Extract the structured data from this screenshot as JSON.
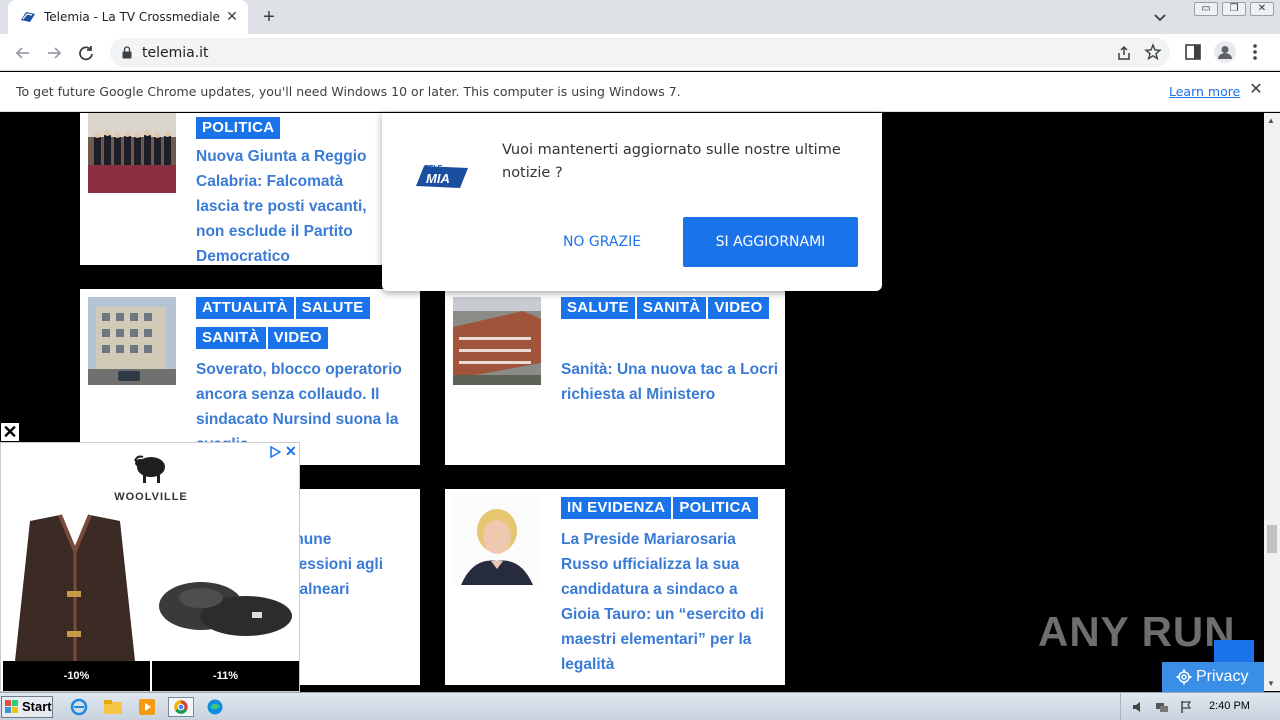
{
  "browser": {
    "tab_title": "Telemia - La TV Crossmediale",
    "url": "telemia.it",
    "infobar_text": "To get future Google Chrome updates, you'll need Windows 10 or later. This computer is using Windows 7.",
    "infobar_link": "Learn more"
  },
  "articles": [
    {
      "tags": [
        "POLITICA"
      ],
      "title": "Nuova Giunta a Reggio Calabria: Falcomatà lascia tre posti vacanti, non esclude il Partito Democratico"
    },
    {
      "tags": [
        "ATTUALITÀ",
        "SALUTE",
        "SANITÀ",
        "VIDEO"
      ],
      "title": "Soverato, blocco operatorio ancora senza collaudo. Il sindacato Nursind suona la sveglia"
    },
    {
      "tags": [
        "SALUTE",
        "SANITÀ",
        "VIDEO"
      ],
      "title": "Sanità: Una nuova tac a Locri richiesta al Ministero"
    },
    {
      "tags": [],
      "title": "mune\ncessioni agli\nbalneari"
    },
    {
      "tags": [
        "IN EVIDENZA",
        "POLITICA"
      ],
      "title": "La Preside Mariarosaria Russo ufficializza la sua candidatura a sindaco a Gioia Tauro: un “esercito di maestri elementari” per la legalità"
    }
  ],
  "notification": {
    "message": "Vuoi mantenerti aggiornato sulle nostre ultime notizie ?",
    "logo_text": "TELE MIA",
    "decline": "NO GRAZIE",
    "accept": "SI AGGIORNAMI"
  },
  "ad": {
    "brand": "WOOLVILLE",
    "discount_1": "-10%",
    "discount_2": "-11%"
  },
  "watermark": "ANY RUN",
  "privacy_label": "Privacy",
  "taskbar": {
    "start_label": "Start",
    "clock": "2:40 PM"
  },
  "colors": {
    "accent": "#1a73e8",
    "headline": "#3a7bd5"
  }
}
